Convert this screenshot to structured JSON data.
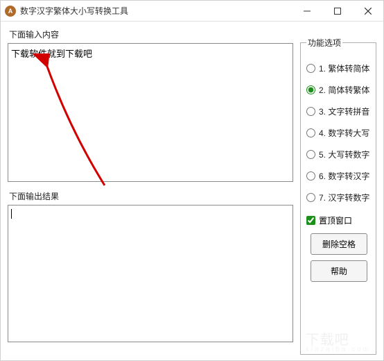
{
  "window": {
    "title": "数字汉字繁体大小写转换工具"
  },
  "labels": {
    "input_section": "下面输入内容",
    "output_section": "下面输出结果"
  },
  "input": {
    "value": "下载软件就到下载吧"
  },
  "output": {
    "value": ""
  },
  "options": {
    "legend": "功能选项",
    "items": [
      {
        "label": "1. 繁体转简体"
      },
      {
        "label": "2. 简体转繁体"
      },
      {
        "label": "3. 文字转拼音"
      },
      {
        "label": "4. 数字转大写"
      },
      {
        "label": "5. 大写转数字"
      },
      {
        "label": "6. 数字转汉字"
      },
      {
        "label": "7. 汉字转数字"
      }
    ],
    "selected_index": 1,
    "always_on_top": {
      "label": "置顶窗口",
      "checked": true
    },
    "buttons": {
      "remove_spaces": "删除空格",
      "help": "帮助"
    }
  },
  "watermark": {
    "main": "下载吧",
    "sub": "xiazaiba.com"
  }
}
